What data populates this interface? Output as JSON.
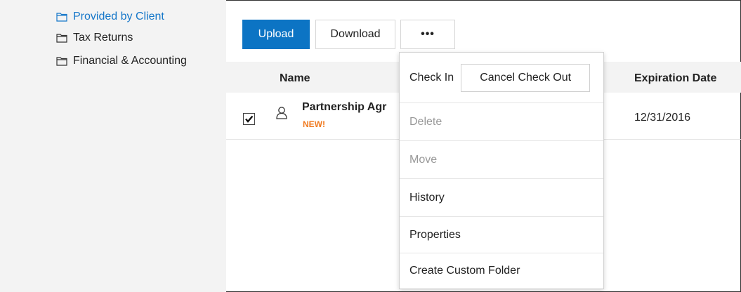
{
  "sidebar": {
    "folders": [
      {
        "label": "Provided by Client",
        "icon": "folder-icon",
        "active": true
      },
      {
        "label": "Tax Returns",
        "icon": "folder-icon",
        "active": false
      },
      {
        "label": "Financial & Accounting",
        "icon": "folder-icon",
        "active": false
      }
    ]
  },
  "toolbar": {
    "upload_label": "Upload",
    "download_label": "Download",
    "more_label": "•••"
  },
  "table": {
    "columns": [
      "Name",
      "Expiration Date"
    ],
    "rows": [
      {
        "checked": true,
        "icon": "user-icon",
        "name": "Partnership Agr",
        "badge": "NEW!",
        "expiration": "12/31/2016"
      }
    ]
  },
  "menu": {
    "check_in": "Check In",
    "cancel_check_out": "Cancel Check Out",
    "delete": "Delete",
    "move": "Move",
    "history": "History",
    "properties": "Properties",
    "create_custom_folder": "Create Custom Folder"
  },
  "colors": {
    "accent": "#0c74c4",
    "active_link": "#1677c9",
    "badge": "#f07a1f",
    "sidebar_bg": "#f3f3f3"
  }
}
